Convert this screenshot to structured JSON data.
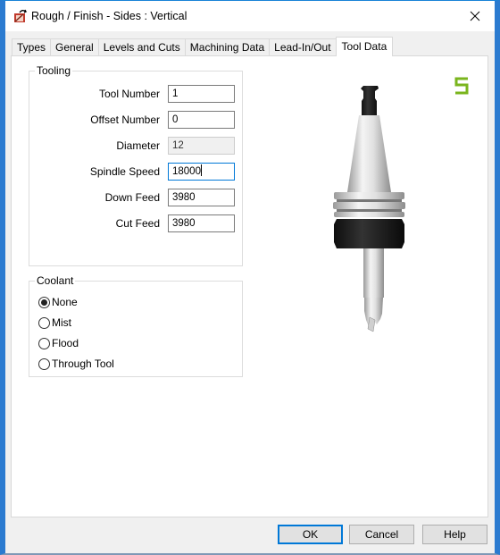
{
  "window": {
    "title": "Rough / Finish - Sides : Vertical",
    "icon": "app-icon",
    "close_icon": "close-icon"
  },
  "tabs": [
    {
      "label": "Types",
      "active": false
    },
    {
      "label": "General",
      "active": false
    },
    {
      "label": "Levels and Cuts",
      "active": false
    },
    {
      "label": "Machining Data",
      "active": false
    },
    {
      "label": "Lead-In/Out",
      "active": false
    },
    {
      "label": "Tool Data",
      "active": true
    }
  ],
  "tooling": {
    "group_label": "Tooling",
    "fields": [
      {
        "label": "Tool Number",
        "value": "1",
        "state": "normal"
      },
      {
        "label": "Offset Number",
        "value": "0",
        "state": "normal"
      },
      {
        "label": "Diameter",
        "value": "12",
        "state": "disabled"
      },
      {
        "label": "Spindle Speed",
        "value": "18000",
        "state": "focused"
      },
      {
        "label": "Down Feed",
        "value": "3980",
        "state": "normal"
      },
      {
        "label": "Cut Feed",
        "value": "3980",
        "state": "normal"
      }
    ]
  },
  "coolant": {
    "group_label": "Coolant",
    "options": [
      {
        "label": "None",
        "checked": true
      },
      {
        "label": "Mist",
        "checked": false
      },
      {
        "label": "Flood",
        "checked": false
      },
      {
        "label": "Through Tool",
        "checked": false
      }
    ]
  },
  "preview": {
    "image": "tool-holder-illustration",
    "logo": "brand-s-logo",
    "logo_color": "#7ab51d"
  },
  "buttons": {
    "ok": "OK",
    "cancel": "Cancel",
    "help": "Help"
  },
  "colors": {
    "accent": "#0078d7",
    "window_border": "#2b7bd0"
  }
}
